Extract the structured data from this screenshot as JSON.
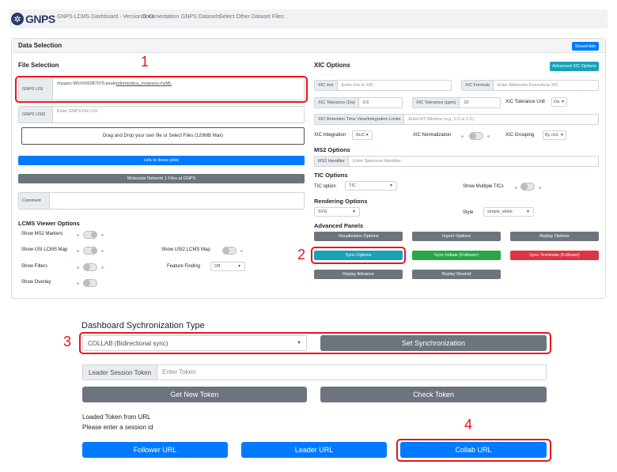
{
  "nav": {
    "logo": "GNPS",
    "items": [
      "GNPS LCMS Dashboard - Version 0.43",
      "Documentation",
      "GNPS Datasets",
      "Select Other Dataset Files"
    ]
  },
  "data_selection": {
    "title": "Data Selection",
    "show_hide": "Show/Hide"
  },
  "file_selection": {
    "title": "File Selection",
    "usi_label": "GNPS USI",
    "usi_value_prefix": "mzspec:MSV000087075:peak/",
    "usi_value_link": "pdomestica_mnavano.mzML",
    "usi2_label": "GNPS USI2",
    "usi2_placeholder": "Enter GNPS File USI",
    "drop_text": "Drag and Drop your own file or Select Files (120MB Max)",
    "link_plots": "Link to these plots",
    "molecular_network": "Molecular Network 1 Files at GNPS",
    "comment_label": "Comment"
  },
  "lcms_viewer": {
    "title": "LCMS Viewer Options",
    "show_ms2": "Show MS2 Markers",
    "show_usi_map": "Show USI LCMS Map",
    "show_usi2_map": "Show USI2 LCMS Map",
    "show_filters": "Show Filters",
    "feature_finding": "Feature Finding",
    "feature_value": "Off",
    "show_overlay": "Show Overlay"
  },
  "xic": {
    "title": "XIC Options",
    "advanced": "Advanced XIC Options",
    "mz_label": "XIC m/z",
    "mz_placeholder": "Enter m/z to XIC",
    "formula_label": "XIC Formula",
    "formula_placeholder": "Enter Molecular Formula to XIC",
    "tol_da_label": "XIC Tolerance (Da)",
    "tol_da_value": "0.5",
    "tol_ppm_label": "XIC Tolerance (ppm)",
    "tol_ppm_value": "10",
    "tol_unit_label": "XIC Tolerance Unit",
    "tol_unit_value": "Da",
    "rt_label": "XIC Retention Time View/Integration Limits",
    "rt_placeholder": "Enter RT Window (e.g. 1-2 or 1.5)",
    "integration_label": "XIC Integration",
    "integration_value": "AUC",
    "normalization_label": "XIC Normalization",
    "grouping_label": "XIC Grouping",
    "grouping_value": "By m/z"
  },
  "ms2": {
    "title": "MS2 Options",
    "id_label": "MS2 Identifier",
    "id_placeholder": "Enter Spectrum Identifier"
  },
  "tic": {
    "title": "TIC Options",
    "option_label": "TIC option",
    "option_value": "TIC",
    "multiple_label": "Show Multiple TICs"
  },
  "rendering": {
    "title": "Rendering Options",
    "format_value": "SVG",
    "style_label": "Style",
    "style_value": "simple_white"
  },
  "advanced_panels": {
    "title": "Advanced Panels",
    "visualization": "Visualization Options",
    "import": "Import Options",
    "replay": "Replay Options",
    "sync": "Sync Options",
    "sync_initiate": "Sync Initiate (Follower)",
    "sync_terminate": "Sync Terminate (Follower)",
    "replay_advance": "Replay Advance",
    "replay_rewind": "Replay Rewind"
  },
  "sync_panel": {
    "title": "Dashboard Sychronization Type",
    "type_value": "COLLAB (Bidirectional sync)",
    "set_sync": "Set Synchronization",
    "leader_label": "Leader Session Token",
    "leader_placeholder": "Enter Token",
    "get_token": "Get New Token",
    "check_token": "Check Token",
    "loaded_line1": "Loaded Token from URL",
    "loaded_line2": "Please enter a session id",
    "follower_url": "Follower URL",
    "leader_url": "Leader URL",
    "collab_url": "Collab URL"
  },
  "annotations": [
    "1",
    "2",
    "3",
    "4"
  ],
  "colors": {
    "primary": "#007bff",
    "secondary": "#6c757d",
    "success": "#28a745",
    "danger": "#dc3545",
    "info": "#17a2b8",
    "annotation": "#e8141c"
  }
}
